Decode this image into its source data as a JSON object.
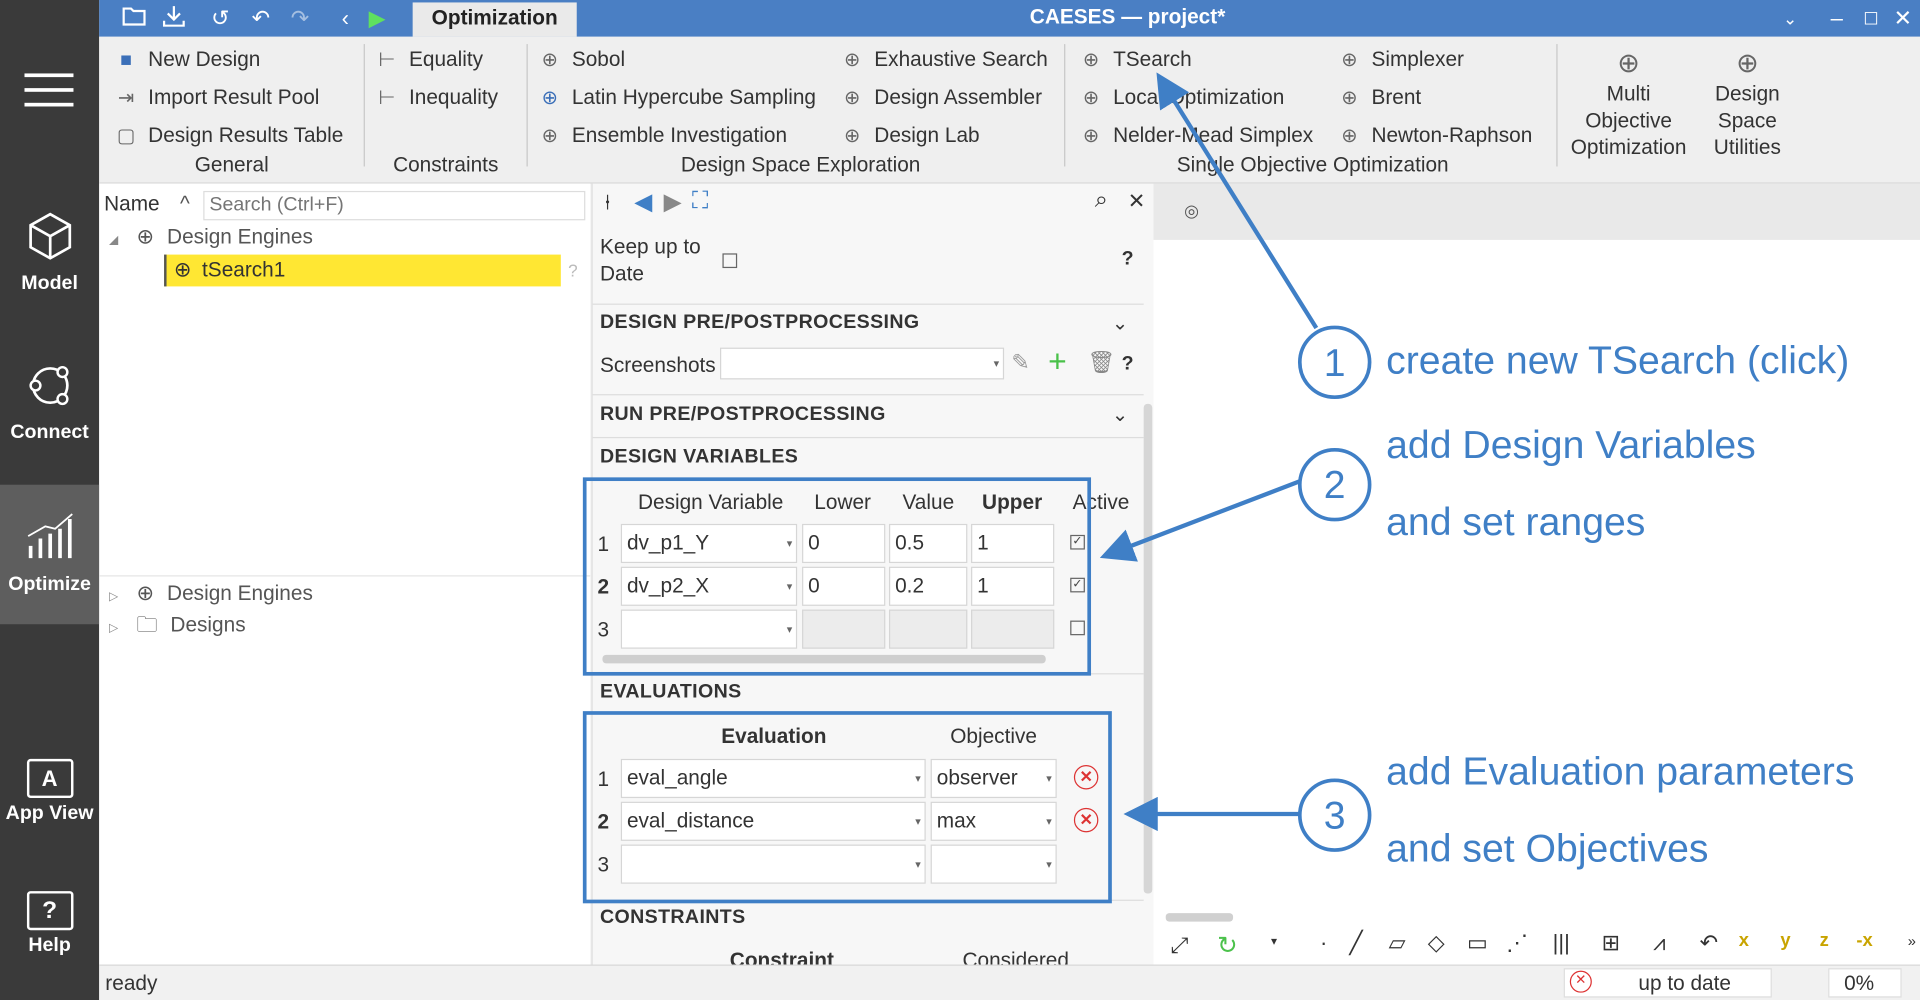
{
  "app": {
    "title": "CAESES — project*",
    "active_tab": "Optimization"
  },
  "dock": [
    {
      "label": "Model",
      "icon": "cube-icon"
    },
    {
      "label": "Connect",
      "icon": "connect-icon"
    },
    {
      "label": "Optimize",
      "icon": "chart-icon"
    },
    {
      "label": "App View",
      "icon": "app-view-icon"
    },
    {
      "label": "Help",
      "icon": "help-icon"
    }
  ],
  "ribbon": {
    "general": {
      "group": "General",
      "items": [
        "New Design",
        "Import Result Pool",
        "Design Results Table"
      ]
    },
    "constraints": {
      "group": "Constraints",
      "items": [
        "Equality",
        "Inequality"
      ]
    },
    "dse": {
      "group": "Design Space Exploration",
      "items": [
        "Sobol",
        "Latin Hypercube Sampling",
        "Ensemble Investigation",
        "Exhaustive Search",
        "Design Assembler",
        "Design Lab"
      ]
    },
    "soo": {
      "group": "Single Objective Optimization",
      "items": [
        "TSearch",
        "Local Optimization",
        "Nelder-Mead Simplex",
        "Simplexer",
        "Brent",
        "Newton-Raphson"
      ]
    },
    "big": [
      {
        "line1": "Multi",
        "line2": "Objective",
        "line3": "Optimization"
      },
      {
        "line1": "Design",
        "line2": "Space",
        "line3": "Utilities"
      }
    ]
  },
  "tree": {
    "name_label": "Name",
    "search_placeholder": "Search (Ctrl+F)",
    "top": {
      "root": "Design Engines",
      "child": "tSearch1",
      "child_hint": "?"
    },
    "bottom": [
      "Design Engines",
      "Designs"
    ]
  },
  "props": {
    "keep_up_to_date": "Keep up to Date",
    "help": "?",
    "sections": {
      "prepost": "DESIGN PRE/POSTPROCESSING",
      "screenshots": "Screenshots",
      "run_prepost": "RUN PRE/POSTPROCESSING",
      "design_variables": "DESIGN VARIABLES",
      "evaluations": "EVALUATIONS",
      "constraints": "CONSTRAINTS"
    },
    "dv_headers": [
      "Design Variable",
      "Lower",
      "Value",
      "Upper",
      "Active"
    ],
    "dv_rows": [
      {
        "n": "1",
        "name": "dv_p1_Y",
        "lower": "0",
        "value": "0.5",
        "upper": "1",
        "active": true
      },
      {
        "n": "2",
        "name": "dv_p2_X",
        "lower": "0",
        "value": "0.2",
        "upper": "1",
        "active": true
      },
      {
        "n": "3",
        "name": "",
        "lower": "",
        "value": "",
        "upper": "",
        "active": false
      }
    ],
    "ev_headers": [
      "Evaluation",
      "Objective"
    ],
    "ev_rows": [
      {
        "n": "1",
        "name": "eval_angle",
        "objective": "observer"
      },
      {
        "n": "2",
        "name": "eval_distance",
        "objective": "max"
      },
      {
        "n": "3",
        "name": "",
        "objective": ""
      }
    ],
    "constraint_headers": [
      "Constraint",
      "Considered"
    ]
  },
  "annotations": {
    "c1": "1",
    "t1": "create new TSearch (click)",
    "c2": "2",
    "t2a": "add Design Variables",
    "t2b": "and set ranges",
    "c3": "3",
    "t3a": "add Evaluation parameters",
    "t3b": "and set Objectives",
    "accent": "#3f7fc6"
  },
  "status": {
    "text": "ready",
    "state": "up to date",
    "progress": "0%"
  }
}
